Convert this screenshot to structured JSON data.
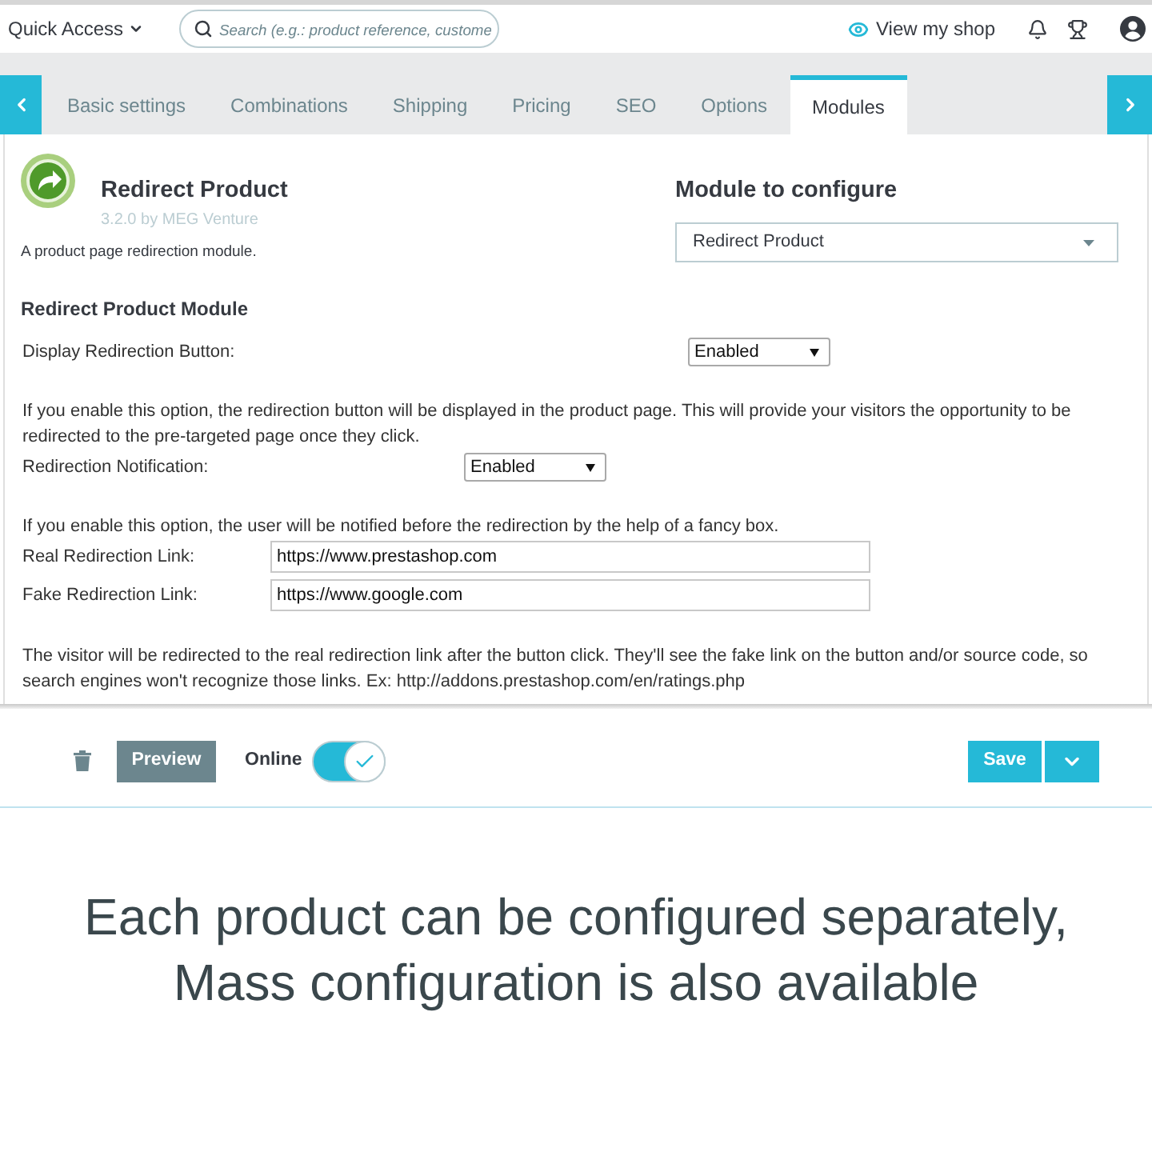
{
  "top_bar": {
    "quick_access": "Quick Access",
    "search": {
      "placeholder": "Search (e.g.: product reference, custome"
    },
    "view_shop": "View my shop"
  },
  "tabs": [
    {
      "label": "Basic settings",
      "selected": false
    },
    {
      "label": "Combinations",
      "selected": false
    },
    {
      "label": "Shipping",
      "selected": false
    },
    {
      "label": "Pricing",
      "selected": false
    },
    {
      "label": "SEO",
      "selected": false
    },
    {
      "label": "Options",
      "selected": false
    },
    {
      "label": "Modules",
      "selected": true
    }
  ],
  "module": {
    "name": "Redirect Product",
    "version": "3.2.0 by MEG Venture",
    "description": "A product page redirection module."
  },
  "module_selector": {
    "title": "Module to configure",
    "value": "Redirect Product"
  },
  "settings": {
    "title": "Redirect Product Module",
    "fields": [
      {
        "kind": "select",
        "label": "Display Redirection Button:",
        "value": "Enabled"
      },
      {
        "kind": "note",
        "text": "If you enable this option, the redirection button will be displayed in the product page. This will provide your visitors the opportunity to be redirected to the pre-targeted page once they click."
      },
      {
        "kind": "select",
        "label": "Redirection Notification:",
        "value": "Enabled"
      },
      {
        "kind": "note",
        "text": "If you enable this option, the user will be notified before the redirection by the help of a fancy box."
      },
      {
        "kind": "text",
        "label": "Real Redirection Link:",
        "value": "https://www.prestashop.com"
      },
      {
        "kind": "text",
        "label": "Fake Redirection Link:",
        "value": "https://www.google.com"
      },
      {
        "kind": "note",
        "text": "The visitor will be redirected to the real redirection link after the button click. They'll see the fake link on the button and/or source code, so search engines won't recognize those links. Ex: http://addons.prestashop.com/en/ratings.php"
      }
    ]
  },
  "footer": {
    "preview": "Preview",
    "online": {
      "label": "Online",
      "on": true
    },
    "save": "Save"
  },
  "caption": "Each product can be configured separately, Mass configuration is also available"
}
